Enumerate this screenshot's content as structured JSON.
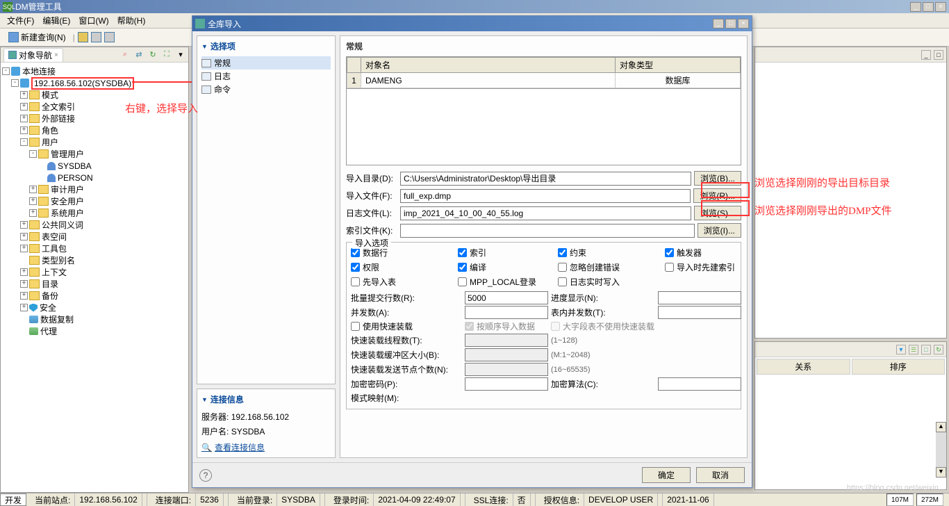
{
  "window": {
    "title": "DM管理工具"
  },
  "menu": {
    "file": "文件(F)",
    "edit": "编辑(E)",
    "window": "窗口(W)",
    "help": "帮助(H)"
  },
  "toolbar": {
    "newQuery": "新建查询(N)"
  },
  "leftPane": {
    "tab": "对象导航"
  },
  "tree": {
    "root": "本地连接",
    "conn": "192.168.56.102(SYSDBA)",
    "items": [
      "模式",
      "全文索引",
      "外部链接",
      "角色",
      "用户",
      "公共同义词",
      "表空间",
      "工具包",
      "类型别名",
      "上下文",
      "目录",
      "备份",
      "安全",
      "数据复制",
      "代理"
    ],
    "user_sub": [
      "管理用户",
      "审计用户",
      "安全用户",
      "系统用户"
    ],
    "mgmt_users": [
      "SYSDBA",
      "PERSON"
    ]
  },
  "annotation": {
    "rightClick": "右键，选择导入",
    "browse1": "浏览选择刚刚的导出目标目录",
    "browse2": "浏览选择刚刚导出的DMP文件"
  },
  "dialog": {
    "title": "全库导入",
    "selectGroup": "选择项",
    "opts": {
      "general": "常规",
      "log": "日志",
      "cmd": "命令"
    },
    "connGroup": "连接信息",
    "server_l": "服务器:",
    "server_v": "192.168.56.102",
    "user_l": "用户名:",
    "user_v": "SYSDBA",
    "viewConn": "查看连接信息",
    "rightTitle": "常规",
    "table": {
      "col1": "对象名",
      "col2": "对象类型",
      "row1_name": "DAMENG",
      "row1_type": "数据库"
    },
    "form": {
      "importDir_l": "导入目录(D):",
      "importDir_v": "C:\\Users\\Administrator\\Desktop\\导出目录",
      "browseB": "浏览(B)...",
      "importFile_l": "导入文件(F):",
      "importFile_v": "full_exp.dmp",
      "browseR": "浏览(R)...",
      "logFile_l": "日志文件(L):",
      "logFile_v": "imp_2021_04_10_00_40_55.log",
      "browseS": "浏览(S)...",
      "indexFile_l": "索引文件(K):",
      "indexFile_v": "",
      "browseI": "浏览(I)..."
    },
    "optionsTitle": "导入选项",
    "checks": {
      "dataRow": "数据行",
      "index": "索引",
      "constraint": "约束",
      "trigger": "触发器",
      "priv": "权限",
      "compile": "编译",
      "ignoreErr": "忽略创建错误",
      "buildIdxFirst": "导入时先建索引",
      "preImport": "先导入表",
      "mppLocal": "MPP_LOCAL登录",
      "logRealtime": "日志实时写入"
    },
    "params": {
      "batchRows_l": "批量提交行数(R):",
      "batchRows_v": "5000",
      "progress_l": "进度显示(N):",
      "concur_l": "并发数(A):",
      "tableConc_l": "表内并发数(T):",
      "fastLoad": "使用快速装载",
      "seqImport": "按顺序导入数据",
      "bigNoFast": "大字段表不使用快速装载",
      "fastThread_l": "快速装载线程数(T):",
      "fastThread_h": "(1~128)",
      "fastBuf_l": "快速装载缓冲区大小(B):",
      "fastBuf_h": "(M:1~2048)",
      "fastNode_l": "快速装载发送节点个数(N):",
      "fastNode_h": "(16~65535)",
      "encPwd_l": "加密密码(P):",
      "encAlg_l": "加密算法(C):",
      "schemaMap_l": "模式映射(M):"
    },
    "ok": "确定",
    "cancel": "取消"
  },
  "bgGrid": {
    "col1": "关系",
    "col2": "排序"
  },
  "status": {
    "dev": "开发",
    "site_l": "当前站点:",
    "site_v": "192.168.56.102",
    "port_l": "连接端口:",
    "port_v": "5236",
    "login_l": "当前登录:",
    "login_v": "SYSDBA",
    "time_l": "登录时间:",
    "time_v": "2021-04-09 22:49:07",
    "ssl_l": "SSL连接:",
    "ssl_v": "否",
    "auth_l": "授权信息:",
    "auth_v": "DEVELOP USER",
    "exp_l": "2021-11-06",
    "mem1": "107M",
    "mem2": "272M"
  },
  "watermark": "https://blog.csdn.net/weixin..."
}
